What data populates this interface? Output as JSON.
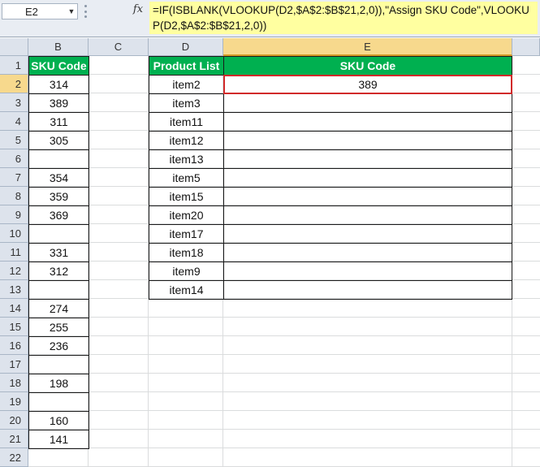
{
  "formula_bar": {
    "name_box": "E2",
    "fx_label": "fx",
    "formula": "=IF(ISBLANK(VLOOKUP(D2,$A$2:$B$21,2,0)),\"Assign SKU Code\",VLOOKUP(D2,$A$2:$B$21,2,0))"
  },
  "columns": [
    "B",
    "C",
    "D",
    "E"
  ],
  "rows": [
    "1",
    "2",
    "3",
    "4",
    "5",
    "6",
    "7",
    "8",
    "9",
    "10",
    "11",
    "12",
    "13",
    "14",
    "15",
    "16",
    "17",
    "18",
    "19",
    "20",
    "21",
    "22"
  ],
  "selection": {
    "column": "E",
    "row": "2"
  },
  "sku_table": {
    "header": "SKU Code",
    "values": [
      "314",
      "389",
      "311",
      "305",
      "",
      "354",
      "359",
      "369",
      "",
      "331",
      "312",
      "",
      "274",
      "255",
      "236",
      "",
      "198",
      "",
      "160",
      "141"
    ]
  },
  "product_table": {
    "headers": [
      "Product List",
      "SKU Code"
    ],
    "rows": [
      {
        "product": "item2",
        "sku": "389"
      },
      {
        "product": "item3",
        "sku": ""
      },
      {
        "product": "item11",
        "sku": ""
      },
      {
        "product": "item12",
        "sku": ""
      },
      {
        "product": "item13",
        "sku": ""
      },
      {
        "product": "item5",
        "sku": ""
      },
      {
        "product": "item15",
        "sku": ""
      },
      {
        "product": "item20",
        "sku": ""
      },
      {
        "product": "item17",
        "sku": ""
      },
      {
        "product": "item18",
        "sku": ""
      },
      {
        "product": "item9",
        "sku": ""
      },
      {
        "product": "item14",
        "sku": ""
      }
    ]
  },
  "colors": {
    "table_header_bg": "#00b050",
    "active_cell_border": "#d12a2a",
    "formula_bg": "#ffffa0"
  }
}
